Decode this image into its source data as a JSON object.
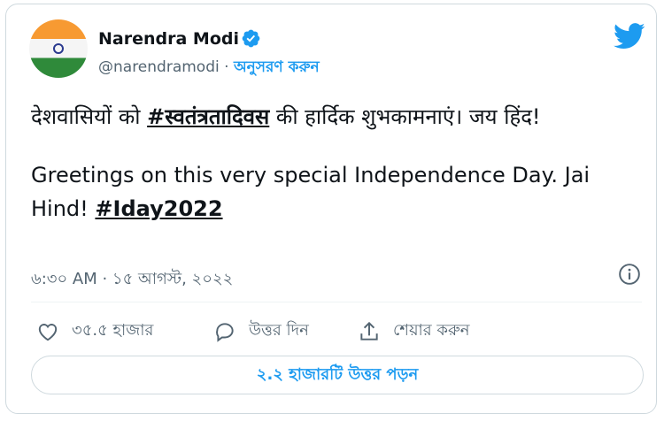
{
  "author": {
    "name": "Narendra Modi",
    "handle": "@narendramodi",
    "separator": "·",
    "follow_label": "অনুসরণ করুন"
  },
  "tweet": {
    "line1_prefix": "देशवासियों को ",
    "line1_hashtag": "#स्वतंत्रतादिवस",
    "line1_suffix": " की हार्दिक शुभकामनाएं। जय हिंद!",
    "line2_text": "Greetings on this very special Independence Day. Jai Hind! ",
    "line2_hashtag": "#Iday2022"
  },
  "timestamp": "৬:৩০ AM · ১৫ আগস্ট, ২০২২",
  "actions": {
    "like_count": "৩৫.৫ হাজার",
    "reply_label": "উত্তর দিন",
    "share_label": "শেয়ার করুন"
  },
  "read_replies_label": "২.২ হাজারটি উত্তর পড়ন",
  "colors": {
    "accent": "#1d9bf0",
    "text": "#0f1419",
    "muted": "#536471",
    "border": "#cfd9de"
  },
  "icons": [
    "verified-badge-icon",
    "twitter-bird-icon",
    "info-icon",
    "heart-icon",
    "reply-bubble-icon",
    "share-icon"
  ]
}
